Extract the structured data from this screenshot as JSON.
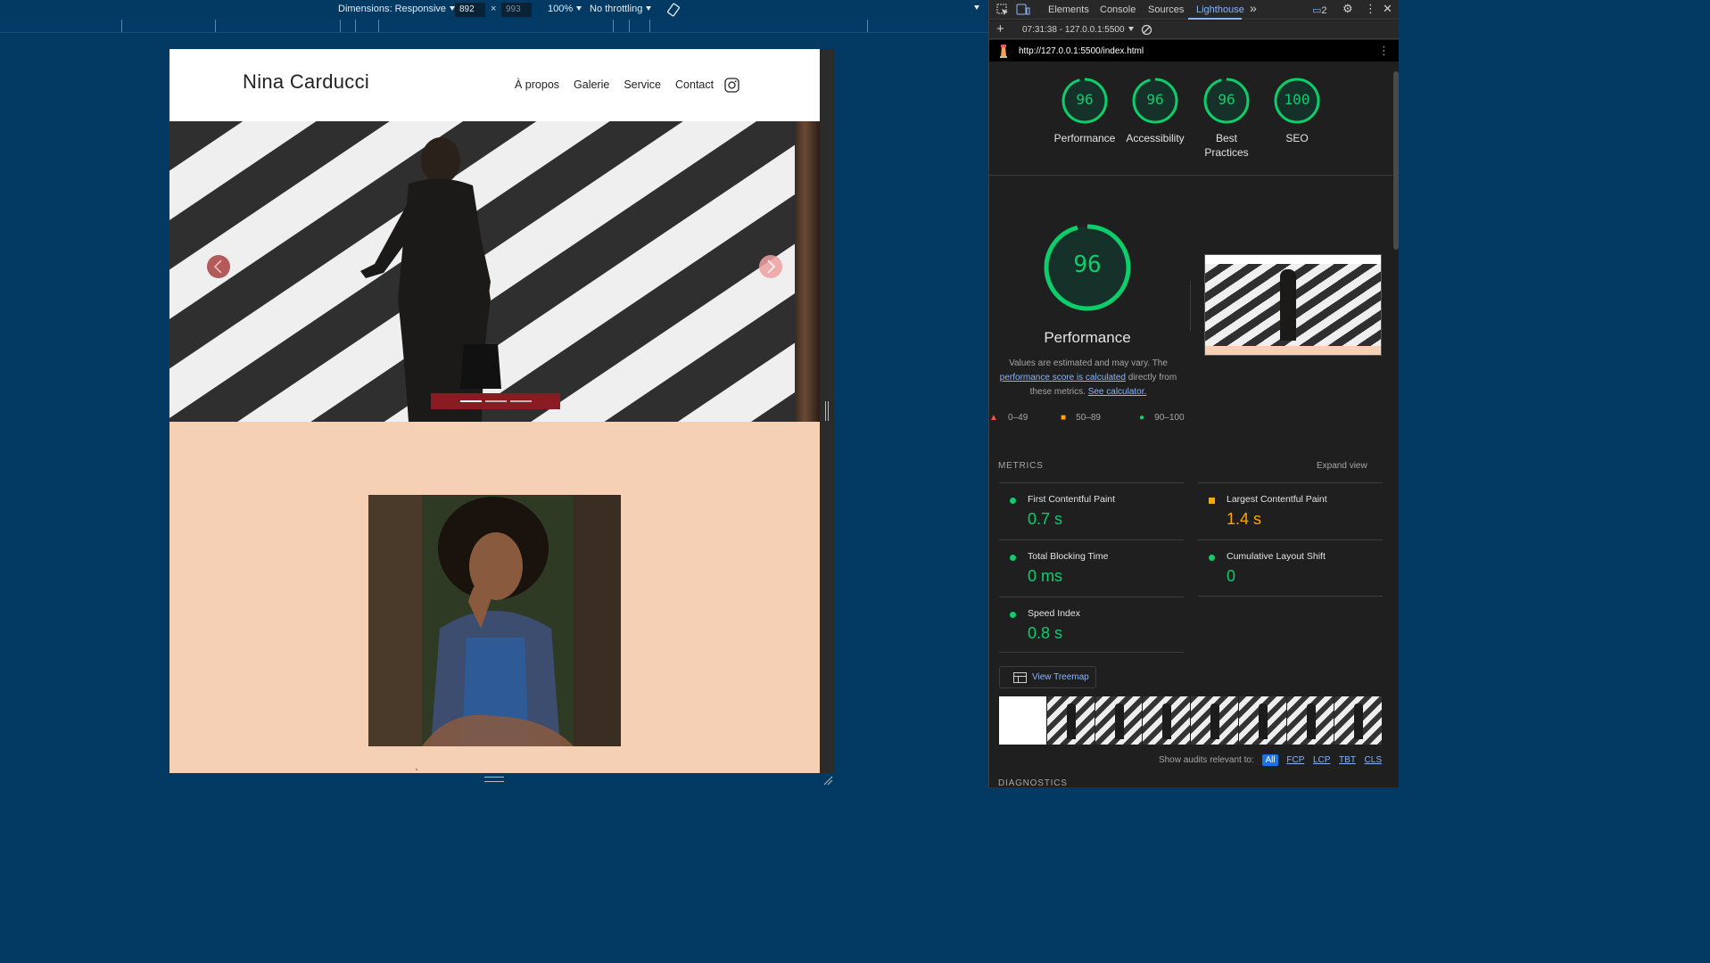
{
  "device_toolbar": {
    "dimensions_label": "Dimensions: Responsive",
    "width": "892",
    "times": "×",
    "height": "993",
    "zoom": "100%",
    "throttling": "No throttling"
  },
  "site": {
    "title": "Nina Carducci",
    "nav": [
      "À propos",
      "Galerie",
      "Service",
      "Contact"
    ],
    "carousel_active_index": 0,
    "carousel_indicator_count": 3,
    "bottom_mark": "`"
  },
  "devtools": {
    "tabs": [
      "Elements",
      "Console",
      "Sources",
      "Lighthouse"
    ],
    "active_tab": "Lighthouse",
    "more": "»",
    "issue_count": "2",
    "report_select": "07:31:38 - 127.0.0.1:5500",
    "url": "http://127.0.0.1:5500/index.html",
    "scores": [
      {
        "label": "Performance",
        "value": "96"
      },
      {
        "label": "Accessibility",
        "value": "96"
      },
      {
        "label": "Best Practices",
        "value": "96"
      },
      {
        "label": "SEO",
        "value": "100"
      }
    ],
    "performance": {
      "score": "96",
      "label": "Performance",
      "desc_1": "Values are estimated and may vary. The",
      "desc_link_1": "performance score is calculated",
      "desc_2": " directly from these metrics. ",
      "desc_link_2": "See calculator."
    },
    "legend": [
      "0–49",
      "50–89",
      "90–100"
    ],
    "metrics_heading": "METRICS",
    "expand_view": "Expand view",
    "metrics": [
      {
        "label": "First Contentful Paint",
        "value": "0.7 s",
        "status": "pass"
      },
      {
        "label": "Largest Contentful Paint",
        "value": "1.4 s",
        "status": "average"
      },
      {
        "label": "Total Blocking Time",
        "value": "0 ms",
        "status": "pass"
      },
      {
        "label": "Cumulative Layout Shift",
        "value": "0",
        "status": "pass"
      },
      {
        "label": "Speed Index",
        "value": "0.8 s",
        "status": "pass"
      }
    ],
    "treemap_label": "View Treemap",
    "show_audits_label": "Show audits relevant to:",
    "audit_filters": [
      "All",
      "FCP",
      "LCP",
      "TBT",
      "CLS"
    ],
    "diagnostics_heading": "DIAGNOSTICS"
  },
  "colors": {
    "pass": "#0cce6b",
    "average": "#ffa400",
    "fail": "#ff4e42",
    "page_bg": "#f5d0b4",
    "devtools_bg": "#1f1f1f",
    "emulator_bg": "#033a63"
  }
}
